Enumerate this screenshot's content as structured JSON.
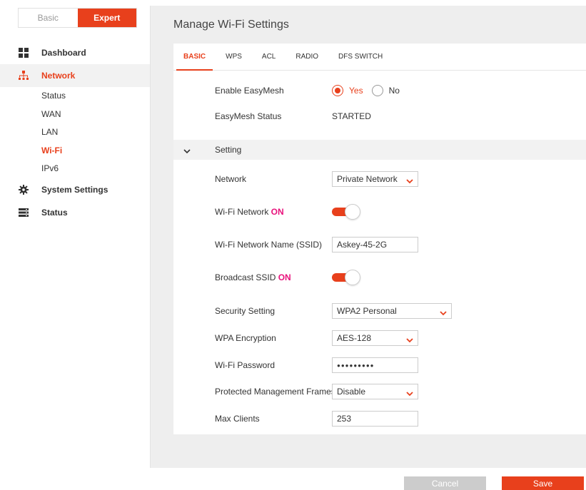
{
  "mode": {
    "basic": "Basic",
    "expert": "Expert"
  },
  "nav": {
    "dashboard": "Dashboard",
    "network": "Network",
    "network_sub": [
      "Status",
      "WAN",
      "LAN",
      "Wi-Fi",
      "IPv6"
    ],
    "system_settings": "System Settings",
    "status": "Status"
  },
  "header": {
    "title": "Manage Wi-Fi Settings"
  },
  "tabs": [
    "BASIC",
    "WPS",
    "ACL",
    "RADIO",
    "DFS SWITCH"
  ],
  "form": {
    "easymesh_label": "Enable EasyMesh",
    "easymesh_yes": "Yes",
    "easymesh_no": "No",
    "easymesh_status_label": "EasyMesh Status",
    "easymesh_status_value": "STARTED",
    "section_setting": "Setting",
    "network_label": "Network",
    "network_value": "Private Network",
    "wifi_network_label": "Wi-Fi Network",
    "wifi_network_state": "ON",
    "ssid_label": "Wi-Fi Network Name (SSID)",
    "ssid_value": "Askey-45-2G",
    "broadcast_label": "Broadcast SSID",
    "broadcast_state": "ON",
    "security_label": "Security Setting",
    "security_value": "WPA2 Personal",
    "encryption_label": "WPA Encryption",
    "encryption_value": "AES-128",
    "password_label": "Wi-Fi Password",
    "password_value": "●●●●●●●●●",
    "pmf_label": "Protected Management Frames",
    "pmf_value": "Disable",
    "max_clients_label": "Max Clients",
    "max_clients_value": "253"
  },
  "footer": {
    "cancel": "Cancel",
    "save": "Save"
  },
  "colors": {
    "accent": "#e8401c",
    "on_text": "#e8127c"
  }
}
